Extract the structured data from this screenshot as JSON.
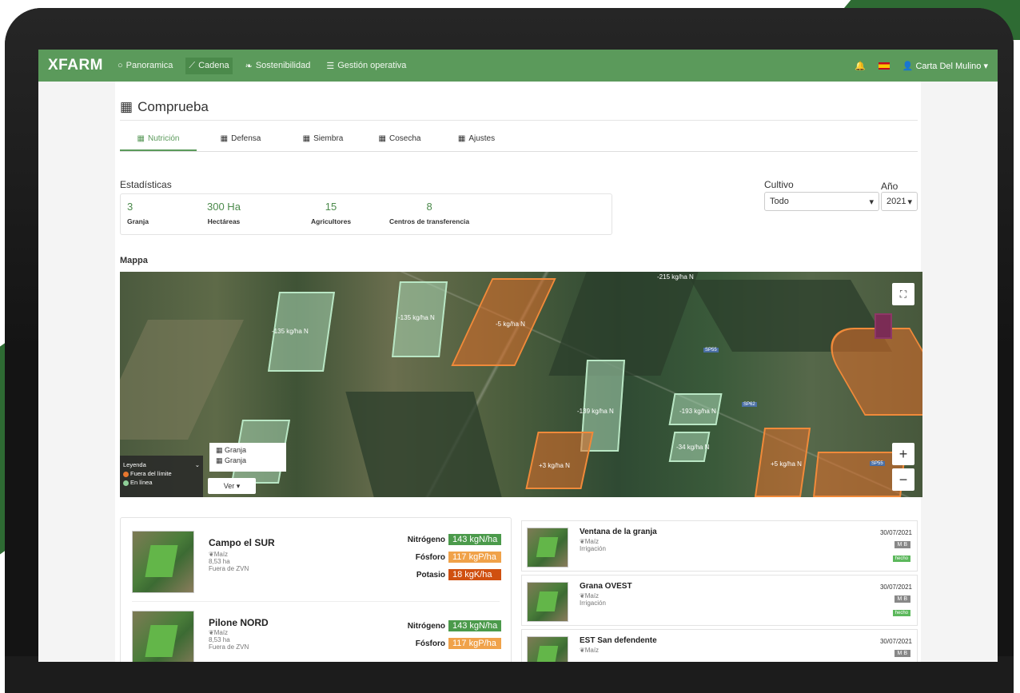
{
  "brand": "XFARM",
  "nav": {
    "items": [
      {
        "icon": "circle-icon",
        "label": "Panoramica"
      },
      {
        "icon": "line-chart-icon",
        "label": "Cadena"
      },
      {
        "icon": "leaf-icon",
        "label": "Sostenibilidad"
      },
      {
        "icon": "list-icon",
        "label": "Gestión operativa"
      }
    ],
    "user": "Carta Del Mulino"
  },
  "page": {
    "title": "Comprueba"
  },
  "tabs": [
    "Nutrición",
    "Defensa",
    "Siembra",
    "Cosecha",
    "Ajustes"
  ],
  "stats": {
    "title": "Estadísticas",
    "items": [
      {
        "value": "3",
        "label": "Granja"
      },
      {
        "value": "300 Ha",
        "label": "Hectáreas"
      },
      {
        "value": "15",
        "label": "Agricultores"
      },
      {
        "value": "8",
        "label": "Centros de transferencia"
      }
    ]
  },
  "filters": {
    "crop_label": "Cultivo",
    "crop_value": "Todo",
    "year_label": "Año",
    "year_value": "2021"
  },
  "map": {
    "title": "Mappa",
    "fields": [
      {
        "label": "-135 kg/ha N"
      },
      {
        "label": "-135 kg/ha N"
      },
      {
        "label": "-5 kg/ha N"
      },
      {
        "label": "-215 kg/ha N"
      },
      {
        "label": "-139 kg/ha N"
      },
      {
        "label": "-193 kg/ha N"
      },
      {
        "label": "-34 kg/ha N"
      },
      {
        "label": "+3 kg/ha N"
      },
      {
        "label": "+5 kg/ha N"
      }
    ],
    "road_labels": [
      "SP55",
      "SP62",
      "SP55"
    ],
    "legend": {
      "title": "Leyenda",
      "items": [
        {
          "color": "#e8772e",
          "label": "Fuera del límite"
        },
        {
          "color": "#8fcf98",
          "label": "En línea"
        }
      ]
    },
    "layers": [
      "Granja",
      "Granja"
    ],
    "ver_label": "Ver",
    "zoom_in": "+",
    "zoom_out": "−"
  },
  "fields_list": [
    {
      "name": "Campo el SUR",
      "crop": "Maíz",
      "area": "8,53 ha",
      "zone": "Fuera de ZVN",
      "nutrients": [
        {
          "label": "Nitrógeno",
          "value": "143 kgN/ha",
          "status": "green"
        },
        {
          "label": "Fósforo",
          "value": "117 kgP/ha",
          "status": "orange"
        },
        {
          "label": "Potasio",
          "value": "18 kgK/ha",
          "status": "red"
        }
      ]
    },
    {
      "name": "Pilone NORD",
      "crop": "Maíz",
      "area": "8,53 ha",
      "zone": "Fuera de ZVN",
      "nutrients": [
        {
          "label": "Nitrógeno",
          "value": "143 kgN/ha",
          "status": "green"
        },
        {
          "label": "Fósforo",
          "value": "117 kgP/ha",
          "status": "orange"
        }
      ]
    }
  ],
  "activities": [
    {
      "name": "Ventana de la granja",
      "crop": "Maíz",
      "type": "Irrigación",
      "date": "30/07/2021",
      "badge": "M B",
      "status": "hecho"
    },
    {
      "name": "Grana OVEST",
      "crop": "Maíz",
      "type": "Irrigación",
      "date": "30/07/2021",
      "badge": "M B",
      "status": "hecho"
    },
    {
      "name": "EST San defendente",
      "crop": "Maíz",
      "type": "",
      "date": "30/07/2021",
      "badge": "M B",
      "status": ""
    }
  ],
  "colors": {
    "accent": "#5b9a5b",
    "orange": "#f0a24a",
    "red": "#d05010"
  }
}
